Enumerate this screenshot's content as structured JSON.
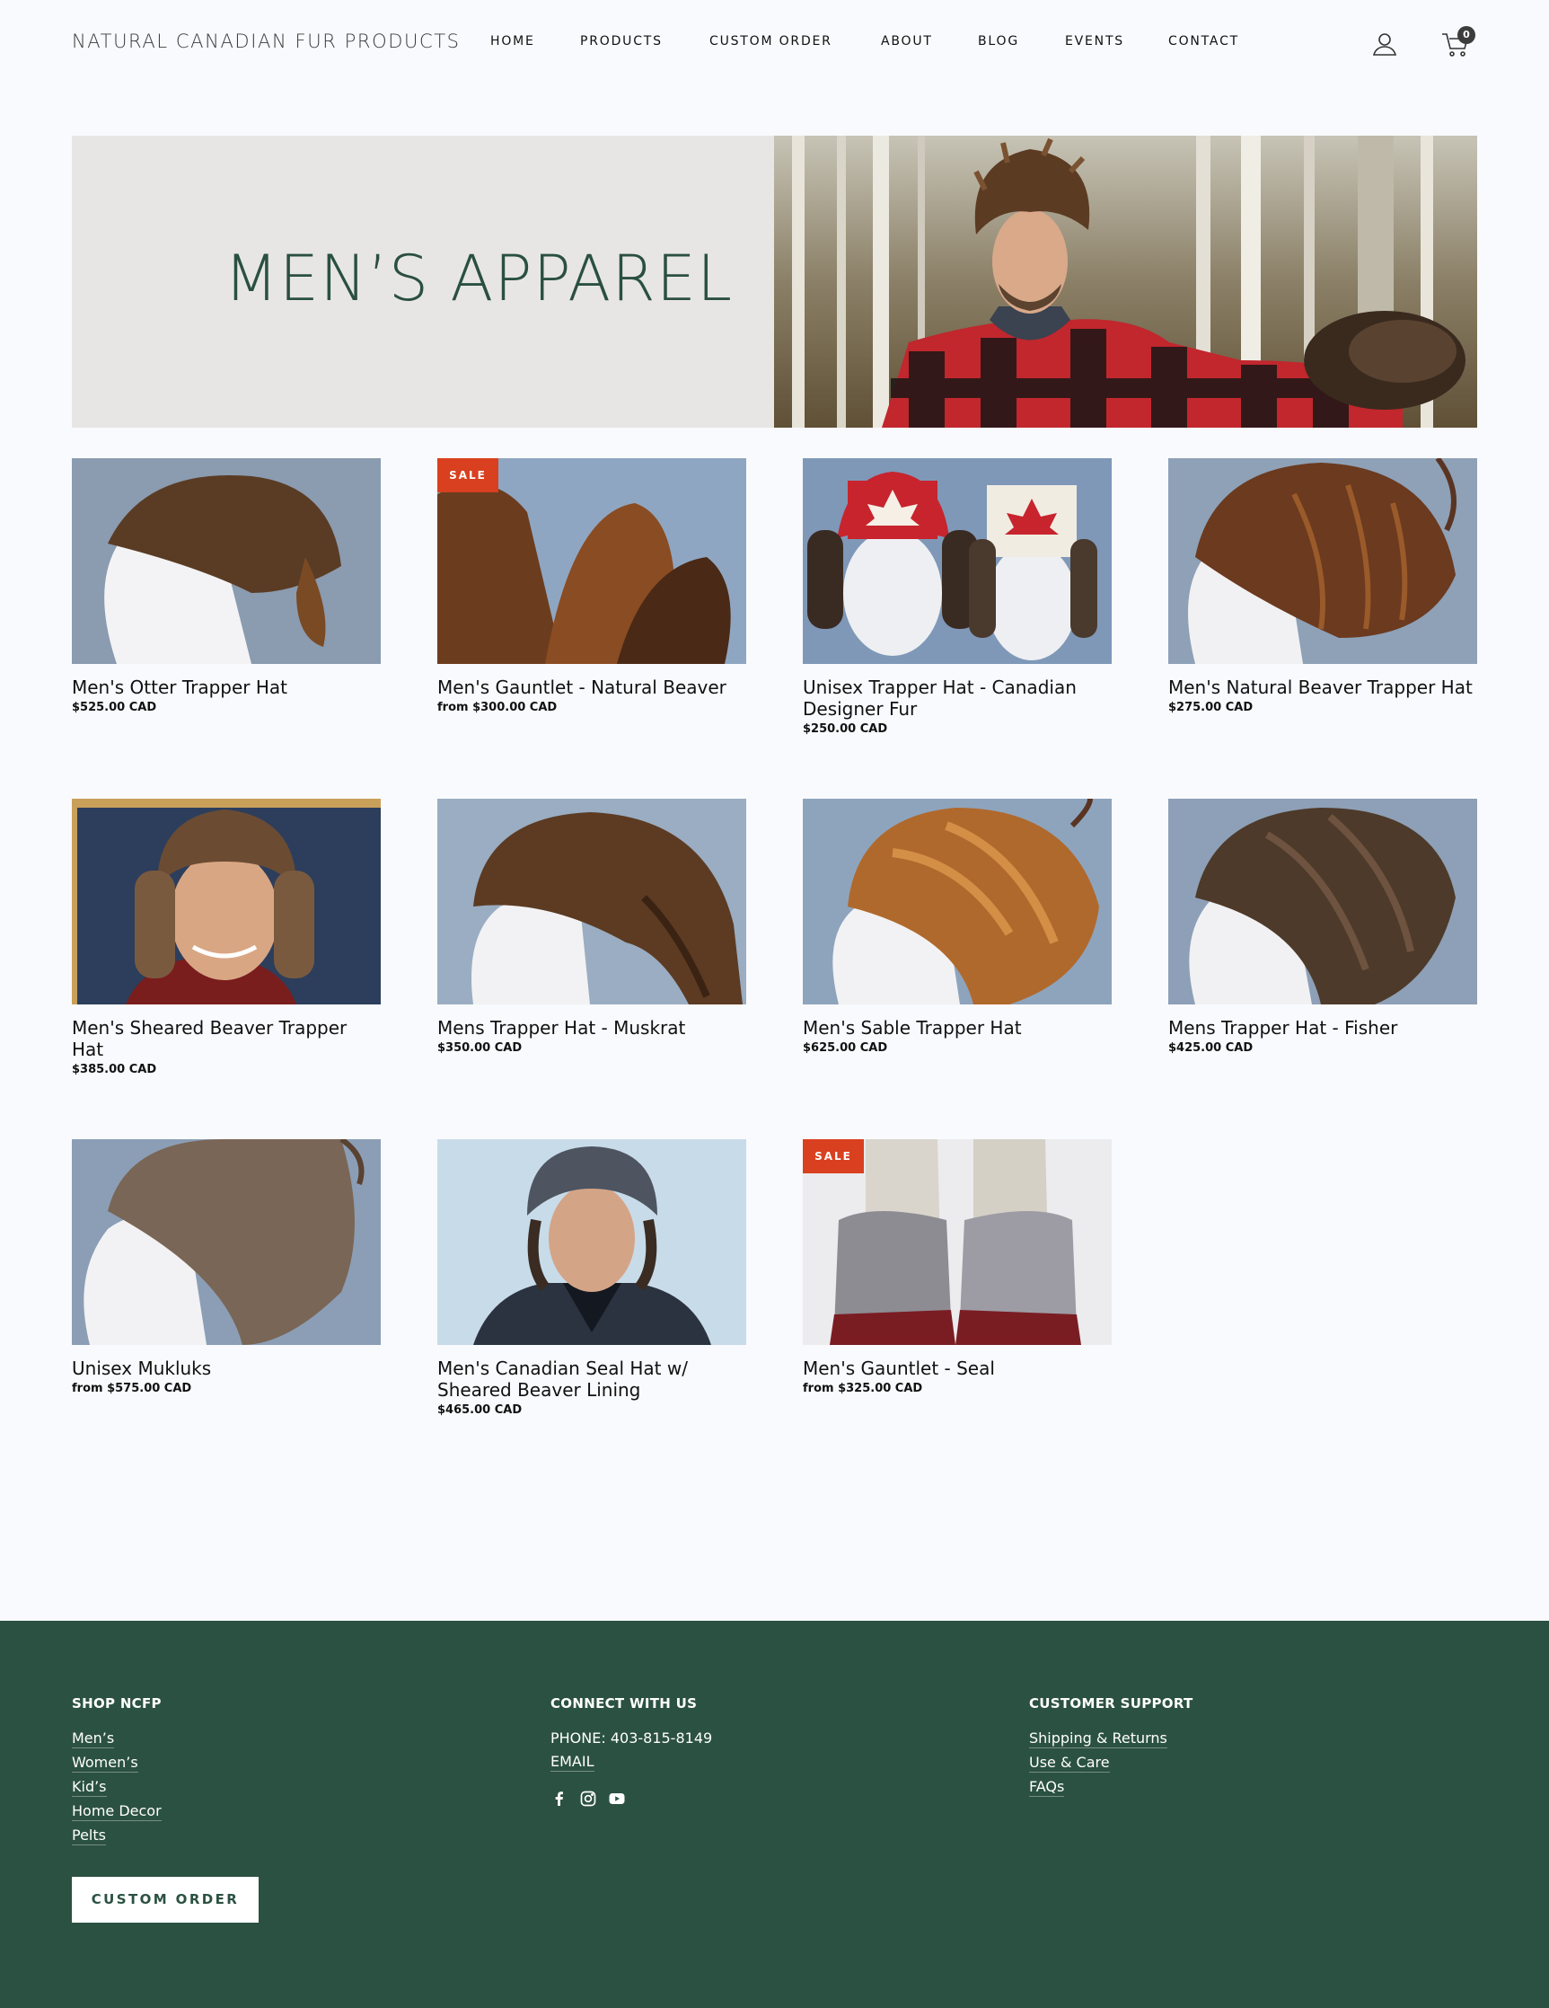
{
  "header": {
    "logo": "NATURAL CANADIAN FUR PRODUCTS",
    "nav": [
      "HOME",
      "PRODUCTS",
      "CUSTOM ORDER",
      "ABOUT",
      "BLOG",
      "EVENTS",
      "CONTACT"
    ],
    "cart_count": "0",
    "icons": {
      "account": "user-icon",
      "cart": "cart-icon"
    }
  },
  "hero": {
    "title": "MEN’S APPAREL"
  },
  "products": [
    {
      "title": "Men's Otter Trapper Hat",
      "price": "$525.00 CAD",
      "sale": false
    },
    {
      "title": "Men's Gauntlet - Natural Beaver",
      "price": "from $300.00 CAD",
      "sale": true
    },
    {
      "title": "Unisex Trapper Hat - Canadian Designer Fur",
      "price": "$250.00 CAD",
      "sale": false
    },
    {
      "title": "Men's Natural Beaver Trapper Hat",
      "price": "$275.00 CAD",
      "sale": false
    },
    {
      "title": "Men's Sheared Beaver Trapper Hat",
      "price": "$385.00 CAD",
      "sale": false
    },
    {
      "title": "Mens Trapper Hat - Muskrat",
      "price": "$350.00 CAD",
      "sale": false
    },
    {
      "title": "Men's Sable Trapper Hat",
      "price": "$625.00 CAD",
      "sale": false
    },
    {
      "title": "Mens Trapper Hat - Fisher",
      "price": "$425.00 CAD",
      "sale": false
    },
    {
      "title": "Unisex Mukluks",
      "price": "from $575.00 CAD",
      "sale": false
    },
    {
      "title": "Men's Canadian Seal Hat w/ Sheared Beaver Lining",
      "price": "$465.00 CAD",
      "sale": false
    },
    {
      "title": "Men's Gauntlet - Seal",
      "price": "from $325.00 CAD",
      "sale": true
    }
  ],
  "sale_label": "SALE",
  "footer": {
    "shop": {
      "heading": "SHOP NCFP",
      "links": [
        "Men’s",
        "Women’s",
        "Kid’s",
        "Home Decor",
        "Pelts"
      ]
    },
    "connect": {
      "heading": "CONNECT WITH US",
      "phone": "PHONE: 403-815-8149",
      "email": "EMAIL",
      "social": [
        "facebook-icon",
        "instagram-icon",
        "youtube-icon"
      ]
    },
    "support": {
      "heading": "CUSTOMER SUPPORT",
      "links": [
        "Shipping & Returns",
        "Use & Care",
        "FAQs"
      ]
    },
    "custom_order_button": "CUSTOM ORDER"
  },
  "colors": {
    "page_bg": "#f9fafd",
    "hero_panel": "#e8e6e5",
    "hero_title": "#2a5040",
    "footer_bg": "#2b5142",
    "sale_badge": "#d9401f"
  }
}
